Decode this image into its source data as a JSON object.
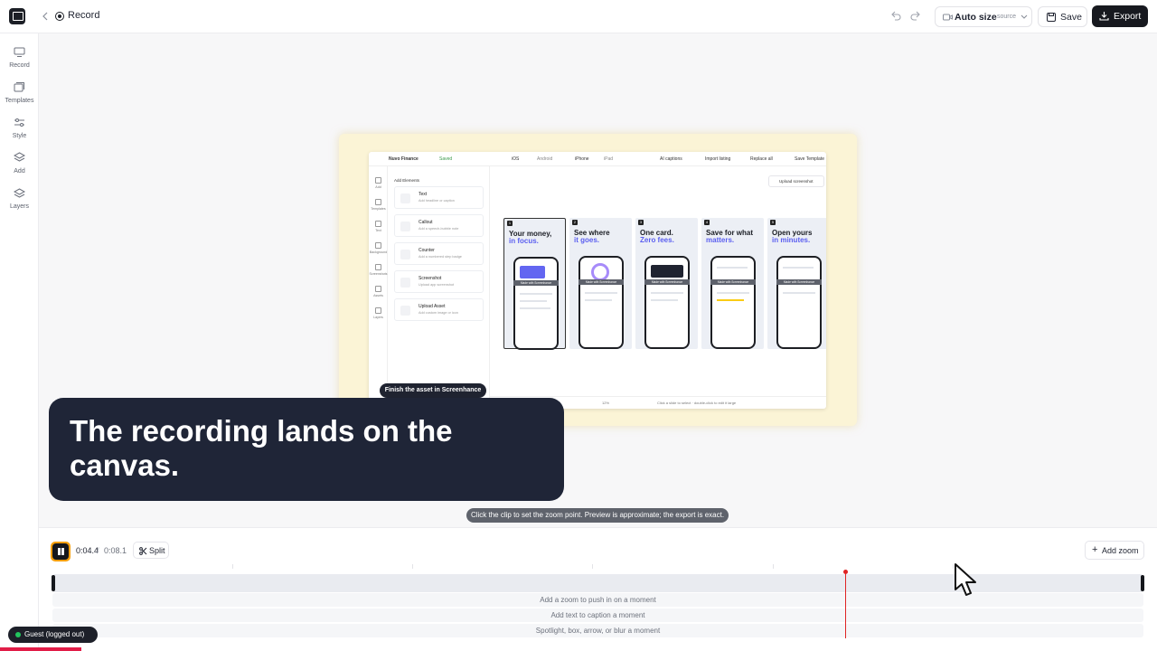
{
  "header": {
    "title": "Record",
    "size_label": "Auto size",
    "size_sub": "source",
    "save_label": "Save",
    "export_label": "Export"
  },
  "rail": {
    "items": [
      {
        "label": "Record",
        "icon": "monitor-icon"
      },
      {
        "label": "Templates",
        "icon": "templates-icon"
      },
      {
        "label": "Style",
        "icon": "sliders-icon"
      },
      {
        "label": "Add",
        "icon": "layers-plus-icon"
      },
      {
        "label": "Layers",
        "icon": "layers-icon"
      }
    ]
  },
  "canvas": {
    "inner_app": {
      "project": "Nuvo Finance",
      "status": "Saved",
      "platforms": [
        "iOS",
        "Android"
      ],
      "devices": [
        "iPhone",
        "iPad"
      ],
      "actions": [
        "AI captions",
        "Import listing",
        "Replace all",
        "Save Template"
      ],
      "rail": [
        "Add",
        "Templates",
        "Text",
        "Background",
        "Screenshots",
        "Assets",
        "Layers"
      ],
      "panel_title": "Add Elements",
      "elements": [
        {
          "title": "Text",
          "desc": "Add headline or caption"
        },
        {
          "title": "Callout",
          "desc": "Add a speech-bubble note"
        },
        {
          "title": "Counter",
          "desc": "Add a numbered step badge"
        },
        {
          "title": "Screenshot",
          "desc": "Upload app screenshot"
        },
        {
          "title": "Upload Asset",
          "desc": "Add custom image or icon"
        }
      ],
      "upload_label": "Upload screenshot",
      "screenshots": [
        {
          "num": "1",
          "line1": "Your money,",
          "line2": "in focus."
        },
        {
          "num": "2",
          "line1": "See where",
          "line2": "it goes."
        },
        {
          "num": "3",
          "line1": "One card.",
          "line2": "Zero fees."
        },
        {
          "num": "4",
          "line1": "Save for what",
          "line2": "matters."
        },
        {
          "num": "5",
          "line1": "Open yours",
          "line2": "in minutes."
        }
      ],
      "watermark": "Made with Screenhance",
      "zoom": "12%",
      "bottom_hint": "Click a slide to select · double-click to edit it large"
    },
    "finish_pill": "Finish the asset in Screenhance",
    "caption": "The recording lands on the canvas.",
    "hint": "Click the clip to set the zoom point. Preview is approximate; the export is exact."
  },
  "timeline": {
    "current": "0:04.4",
    "separator": "/",
    "total": "0:08.1",
    "split_label": "Split",
    "add_zoom_label": "Add zoom",
    "lanes": [
      "Add a zoom to push in on a moment",
      "Add text to caption a moment",
      "Spotlight, box, arrow, or blur a moment"
    ],
    "progress": 0.54
  },
  "user": {
    "status": "Guest (logged out)"
  },
  "colors": {
    "accent": "#f59e0b",
    "playhead": "#e02424",
    "caption_bg": "#1f2537",
    "stage_bg": "#fbf4d6"
  }
}
